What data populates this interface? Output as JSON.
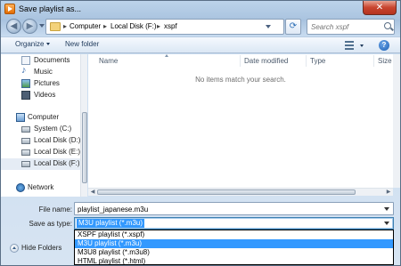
{
  "window": {
    "title": "Save playlist as...",
    "close_glyph": "✕"
  },
  "nav": {
    "back_glyph": "◀",
    "forward_glyph": "▶",
    "breadcrumbs": [
      "Computer",
      "Local Disk (F:)",
      "xspf"
    ],
    "separator": "▸",
    "refresh_glyph": "⟳",
    "search_placeholder": "Search xspf"
  },
  "toolbar": {
    "organize_label": "Organize",
    "new_folder_label": "New folder",
    "help_glyph": "?"
  },
  "sidebar": {
    "items": [
      {
        "label": "Documents",
        "icon": "documents-icon"
      },
      {
        "label": "Music",
        "icon": "music-icon"
      },
      {
        "label": "Pictures",
        "icon": "pictures-icon"
      },
      {
        "label": "Videos",
        "icon": "videos-icon"
      },
      {
        "label": "Computer",
        "icon": "computer-icon"
      },
      {
        "label": "System (C:)",
        "icon": "drive-icon"
      },
      {
        "label": "Local Disk (D:)",
        "icon": "drive-icon"
      },
      {
        "label": "Local Disk (E:)",
        "icon": "drive-icon"
      },
      {
        "label": "Local Disk (F:)",
        "icon": "drive-icon",
        "selected": true
      },
      {
        "label": "Network",
        "icon": "network-icon"
      }
    ]
  },
  "file_list": {
    "columns": [
      "Name",
      "Date modified",
      "Type",
      "Size"
    ],
    "empty_message": "No items match your search."
  },
  "form": {
    "file_name_label": "File name:",
    "file_name_value": "playlist_japanese.m3u",
    "save_as_type_label": "Save as type:",
    "save_as_type_value": "M3U playlist (*.m3u)",
    "type_options": [
      "XSPF playlist (*.xspf)",
      "M3U playlist (*.m3u)",
      "M3U8 playlist (*.m3u8)",
      "HTML playlist (*.html)"
    ],
    "selected_option_index": 1,
    "hide_folders_label": "Hide Folders"
  },
  "colors": {
    "selection": "#3399ff",
    "window_frame": "#bcd3ea",
    "close_button": "#c8442e"
  }
}
